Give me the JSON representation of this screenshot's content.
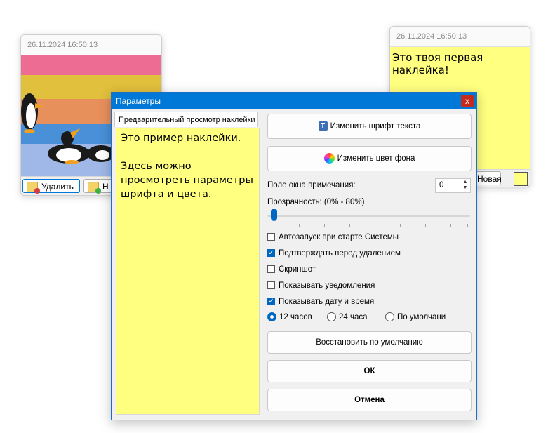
{
  "note_left": {
    "timestamp": "26.11.2024 16:50:13",
    "delete_label": "Удалить",
    "new_label_partial": "Н",
    "stripe_colors": [
      "#ec6c94",
      "#e0c03c",
      "#e8905c",
      "#4a90d9",
      "#9fb8e8"
    ]
  },
  "note_right": {
    "timestamp": "26.11.2024 16:50:13",
    "text": "Это твоя первая наклейка!",
    "new_label": "Новая"
  },
  "dialog": {
    "title": "Параметры",
    "close_glyph": "x",
    "preview_tab": "Предварительный просмотр наклейки",
    "preview_lines": [
      "Это пример наклейки.",
      "Здесь можно просмотреть параметры шрифта и цвета."
    ],
    "change_font_label": "Изменить шрифт текста",
    "change_color_label": "Изменить цвет фона",
    "margin_label": "Поле окна примечания:",
    "margin_value": "0",
    "opacity_label": "Прозрачность: (0% - 80%)",
    "opacity_value": 0,
    "checkboxes": [
      {
        "label": "Автозапуск при старте Системы",
        "checked": false
      },
      {
        "label": "Подтверждать перед удалением",
        "checked": true
      },
      {
        "label": "Скриншот",
        "checked": false
      },
      {
        "label": "Показывать уведомления",
        "checked": false
      },
      {
        "label": "Показывать дату и время",
        "checked": true
      }
    ],
    "radios": [
      {
        "label": "12 часов",
        "selected": true
      },
      {
        "label": "24 часа",
        "selected": false
      },
      {
        "label": "По умолчани",
        "selected": false
      }
    ],
    "restore_defaults_label": "Восстановить по умолчанию",
    "ok_label": "ОК",
    "cancel_label": "Отмена",
    "accent_color": "#0078d7",
    "note_color": "#ffff80"
  }
}
